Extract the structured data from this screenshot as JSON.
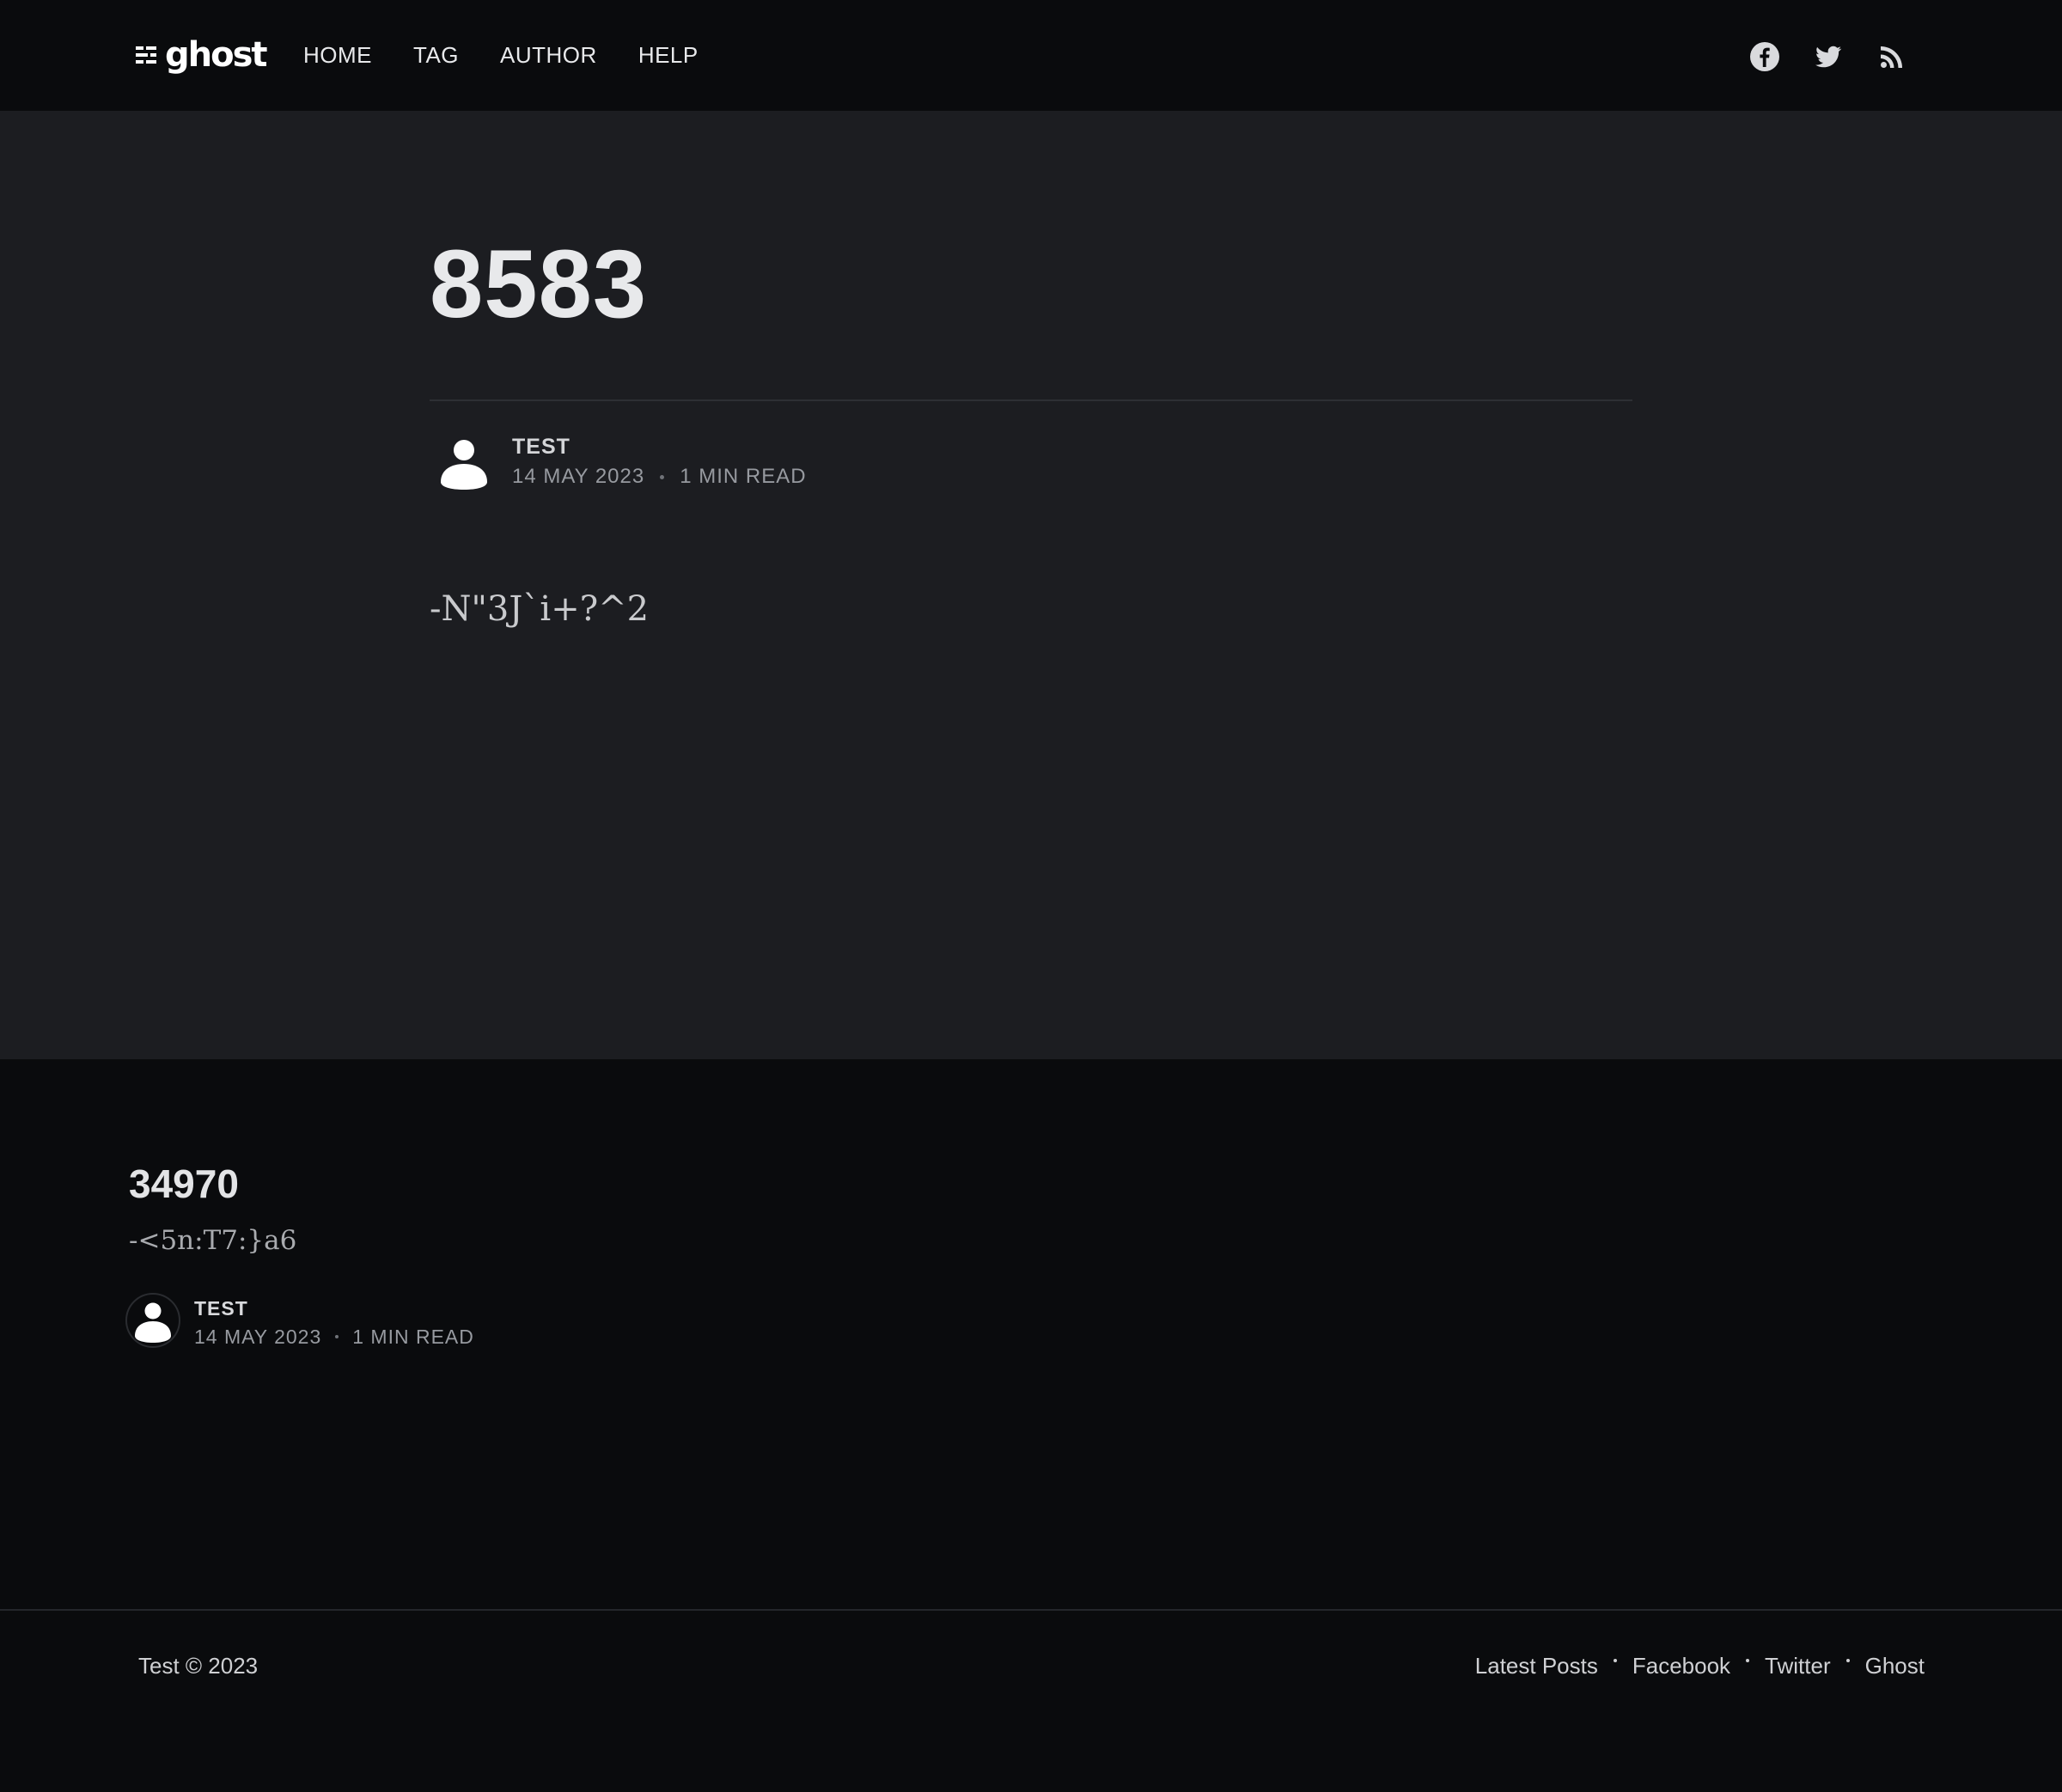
{
  "header": {
    "logo_text": "ghost",
    "nav": [
      {
        "label": "HOME"
      },
      {
        "label": "TAG"
      },
      {
        "label": "AUTHOR"
      },
      {
        "label": "HELP"
      }
    ],
    "social": [
      {
        "icon": "facebook-icon"
      },
      {
        "icon": "twitter-icon"
      },
      {
        "icon": "rss-icon"
      }
    ]
  },
  "post": {
    "title": "8583",
    "author": "TEST",
    "date": "14 MAY 2023",
    "read_time": "1 MIN READ",
    "content": "-N\"3J`i+?^2"
  },
  "related": {
    "title": "34970",
    "excerpt": "-<5n:T7:}a6",
    "author": "TEST",
    "date": "14 MAY 2023",
    "read_time": "1 MIN READ"
  },
  "footer": {
    "copyright": "Test © 2023",
    "links": [
      {
        "label": "Latest Posts"
      },
      {
        "label": "Facebook"
      },
      {
        "label": "Twitter"
      },
      {
        "label": "Ghost"
      }
    ]
  },
  "colors": {
    "header_bg": "#0a0b0d",
    "main_bg": "#1c1d21",
    "text": "#e8e9eb"
  }
}
